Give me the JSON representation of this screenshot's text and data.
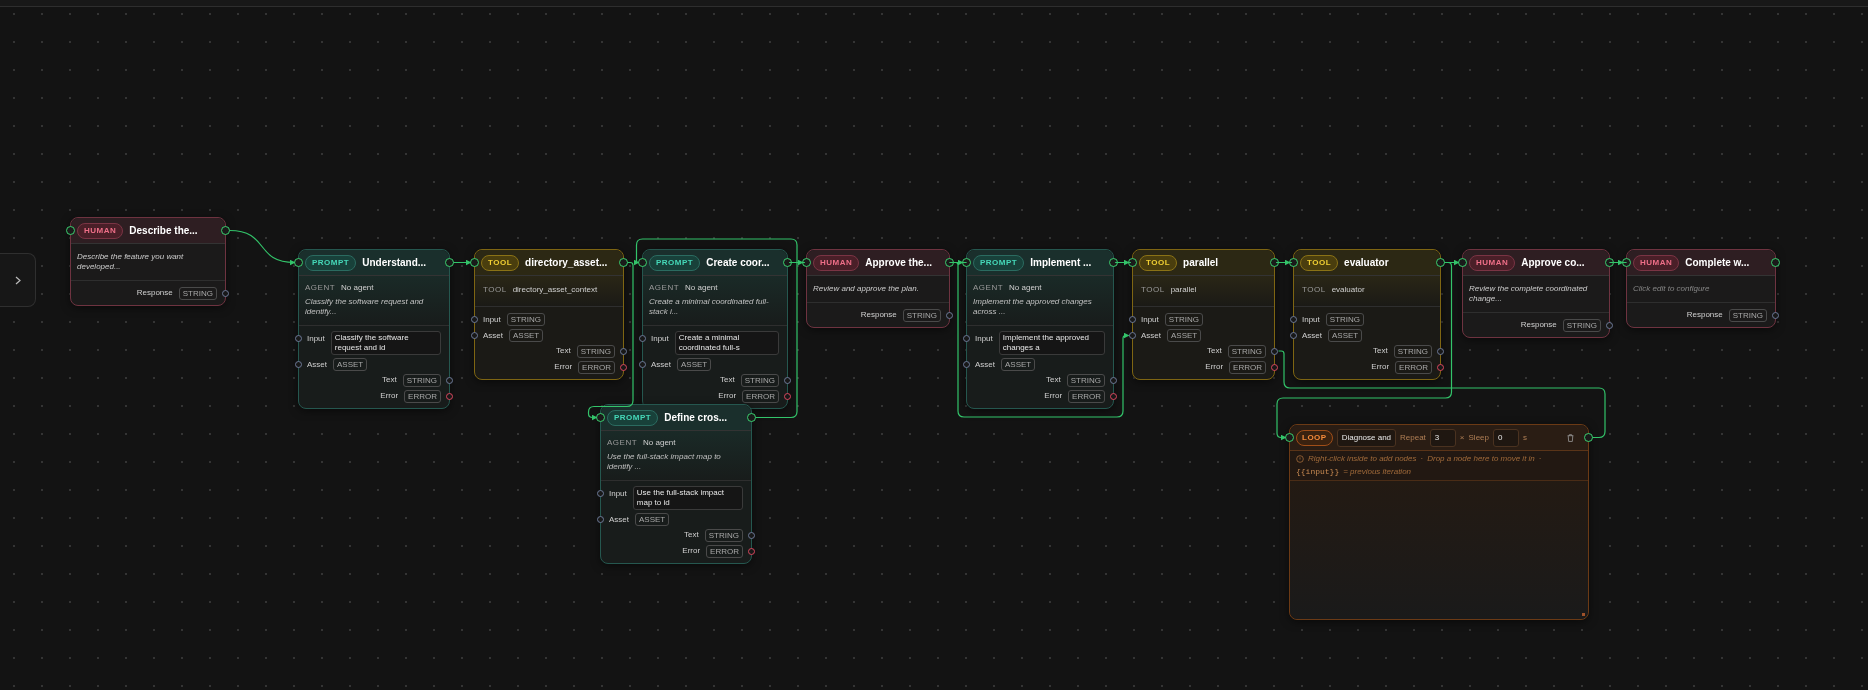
{
  "sidebar_toggle": {
    "expanded": false
  },
  "nodes": [
    {
      "kind": "human",
      "badge": "HUMAN",
      "title": "Describe the...",
      "description": "Describe the feature you want developed...",
      "configured": true,
      "outputs": [
        {
          "label": "Response",
          "type": "STRING"
        }
      ]
    },
    {
      "kind": "prompt",
      "badge": "PROMPT",
      "title": "Understand...",
      "agent_label": "AGENT",
      "agent": "No agent",
      "description": "Classify the software request and identify...",
      "inputs": [
        {
          "label": "Input",
          "value": "Classify the software request and id"
        },
        {
          "label": "Asset",
          "type": "ASSET"
        }
      ],
      "outputs": [
        {
          "label": "Text",
          "type": "STRING"
        },
        {
          "label": "Error",
          "type": "ERROR"
        }
      ]
    },
    {
      "kind": "tool",
      "badge": "TOOL",
      "title": "directory_asset...",
      "tool_label": "TOOL",
      "tool": "directory_asset_context",
      "inputs": [
        {
          "label": "Input",
          "type": "STRING"
        },
        {
          "label": "Asset",
          "type": "ASSET"
        }
      ],
      "outputs": [
        {
          "label": "Text",
          "type": "STRING"
        },
        {
          "label": "Error",
          "type": "ERROR"
        }
      ]
    },
    {
      "kind": "prompt",
      "badge": "PROMPT",
      "title": "Create coor...",
      "agent_label": "AGENT",
      "agent": "No agent",
      "description": "Create a minimal coordinated full-stack i...",
      "inputs": [
        {
          "label": "Input",
          "value": "Create a minimal coordinated full-s"
        },
        {
          "label": "Asset",
          "type": "ASSET"
        }
      ],
      "outputs": [
        {
          "label": "Text",
          "type": "STRING"
        },
        {
          "label": "Error",
          "type": "ERROR"
        }
      ]
    },
    {
      "kind": "prompt",
      "badge": "PROMPT",
      "title": "Define cros...",
      "agent_label": "AGENT",
      "agent": "No agent",
      "description": "Use the full-stack impact map to identify ...",
      "inputs": [
        {
          "label": "Input",
          "value": "Use the full-stack impact map to id"
        },
        {
          "label": "Asset",
          "type": "ASSET"
        }
      ],
      "outputs": [
        {
          "label": "Text",
          "type": "STRING"
        },
        {
          "label": "Error",
          "type": "ERROR"
        }
      ]
    },
    {
      "kind": "human",
      "badge": "HUMAN",
      "title": "Approve the...",
      "description": "Review and approve the plan.",
      "configured": true,
      "outputs": [
        {
          "label": "Response",
          "type": "STRING"
        }
      ]
    },
    {
      "kind": "prompt",
      "badge": "PROMPT",
      "title": "Implement ...",
      "agent_label": "AGENT",
      "agent": "No agent",
      "description": "Implement the approved changes across ...",
      "inputs": [
        {
          "label": "Input",
          "value": "Implement the approved changes a"
        },
        {
          "label": "Asset",
          "type": "ASSET"
        }
      ],
      "outputs": [
        {
          "label": "Text",
          "type": "STRING"
        },
        {
          "label": "Error",
          "type": "ERROR"
        }
      ]
    },
    {
      "kind": "tool",
      "badge": "TOOL",
      "title": "parallel",
      "tool_label": "TOOL",
      "tool": "parallel",
      "inputs": [
        {
          "label": "Input",
          "type": "STRING"
        },
        {
          "label": "Asset",
          "type": "ASSET"
        }
      ],
      "outputs": [
        {
          "label": "Text",
          "type": "STRING"
        },
        {
          "label": "Error",
          "type": "ERROR"
        }
      ]
    },
    {
      "kind": "tool",
      "badge": "TOOL",
      "title": "evaluator",
      "tool_label": "TOOL",
      "tool": "evaluator",
      "inputs": [
        {
          "label": "Input",
          "type": "STRING"
        },
        {
          "label": "Asset",
          "type": "ASSET"
        }
      ],
      "outputs": [
        {
          "label": "Text",
          "type": "STRING"
        },
        {
          "label": "Error",
          "type": "ERROR"
        }
      ]
    },
    {
      "kind": "human",
      "badge": "HUMAN",
      "title": "Approve co...",
      "description": "Review the complete coordinated change...",
      "configured": true,
      "outputs": [
        {
          "label": "Response",
          "type": "STRING"
        }
      ]
    },
    {
      "kind": "human",
      "badge": "HUMAN",
      "title": "Complete w...",
      "description": "Click edit to configure",
      "configured": false,
      "outputs": [
        {
          "label": "Response",
          "type": "STRING"
        }
      ]
    },
    {
      "kind": "loop",
      "badge": "LOOP",
      "name": "Diagnose and",
      "repeat_label": "Repeat",
      "repeat": "3",
      "times": "×",
      "sleep_label": "Sleep",
      "sleep": "0",
      "sleep_unit": "s",
      "hint": [
        "Right-click inside to add nodes",
        "·",
        "Drop a node here to move it in",
        "·",
        "{{input}}",
        "= previous iteration"
      ]
    }
  ]
}
